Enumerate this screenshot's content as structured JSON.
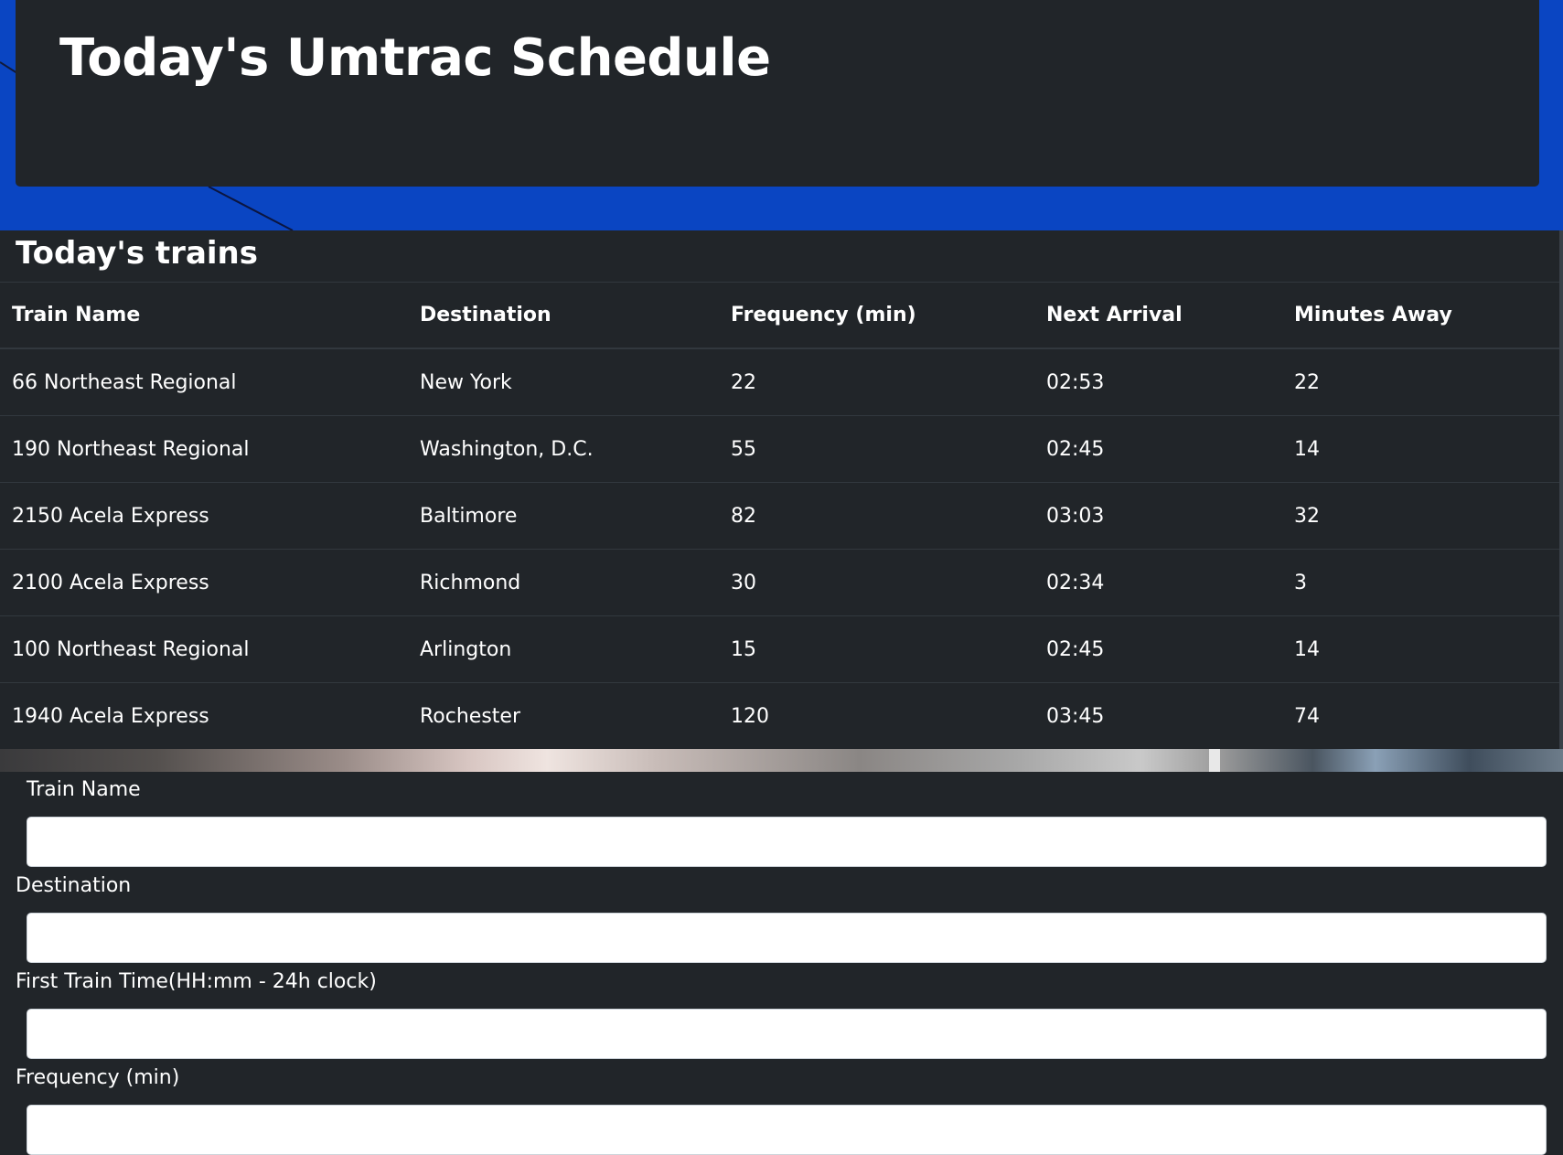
{
  "header": {
    "title": "Today's Umtrac Schedule"
  },
  "schedule": {
    "heading": "Today's trains",
    "columns": [
      "Train Name",
      "Destination",
      "Frequency (min)",
      "Next Arrival",
      "Minutes Away"
    ],
    "rows": [
      [
        "66 Northeast Regional",
        "New York",
        "22",
        "02:53",
        "22"
      ],
      [
        "190 Northeast Regional",
        "Washington, D.C.",
        "55",
        "02:45",
        "14"
      ],
      [
        "2150 Acela Express",
        "Baltimore",
        "82",
        "03:03",
        "32"
      ],
      [
        "2100 Acela Express",
        "Richmond",
        "30",
        "02:34",
        "3"
      ],
      [
        "100 Northeast Regional",
        "Arlington",
        "15",
        "02:45",
        "14"
      ],
      [
        "1940 Acela Express",
        "Rochester",
        "120",
        "03:45",
        "74"
      ]
    ]
  },
  "form": {
    "train_name_label": "Train Name",
    "train_name_value": "",
    "destination_label": "Destination",
    "destination_value": "",
    "first_time_label": "First Train Time(HH:mm - 24h clock)",
    "first_time_value": "",
    "frequency_label": "Frequency (min)",
    "frequency_value": ""
  },
  "colors": {
    "panel_bg": "#212529",
    "background_blue": "#0a45c2",
    "input_bg": "#ffffff"
  }
}
